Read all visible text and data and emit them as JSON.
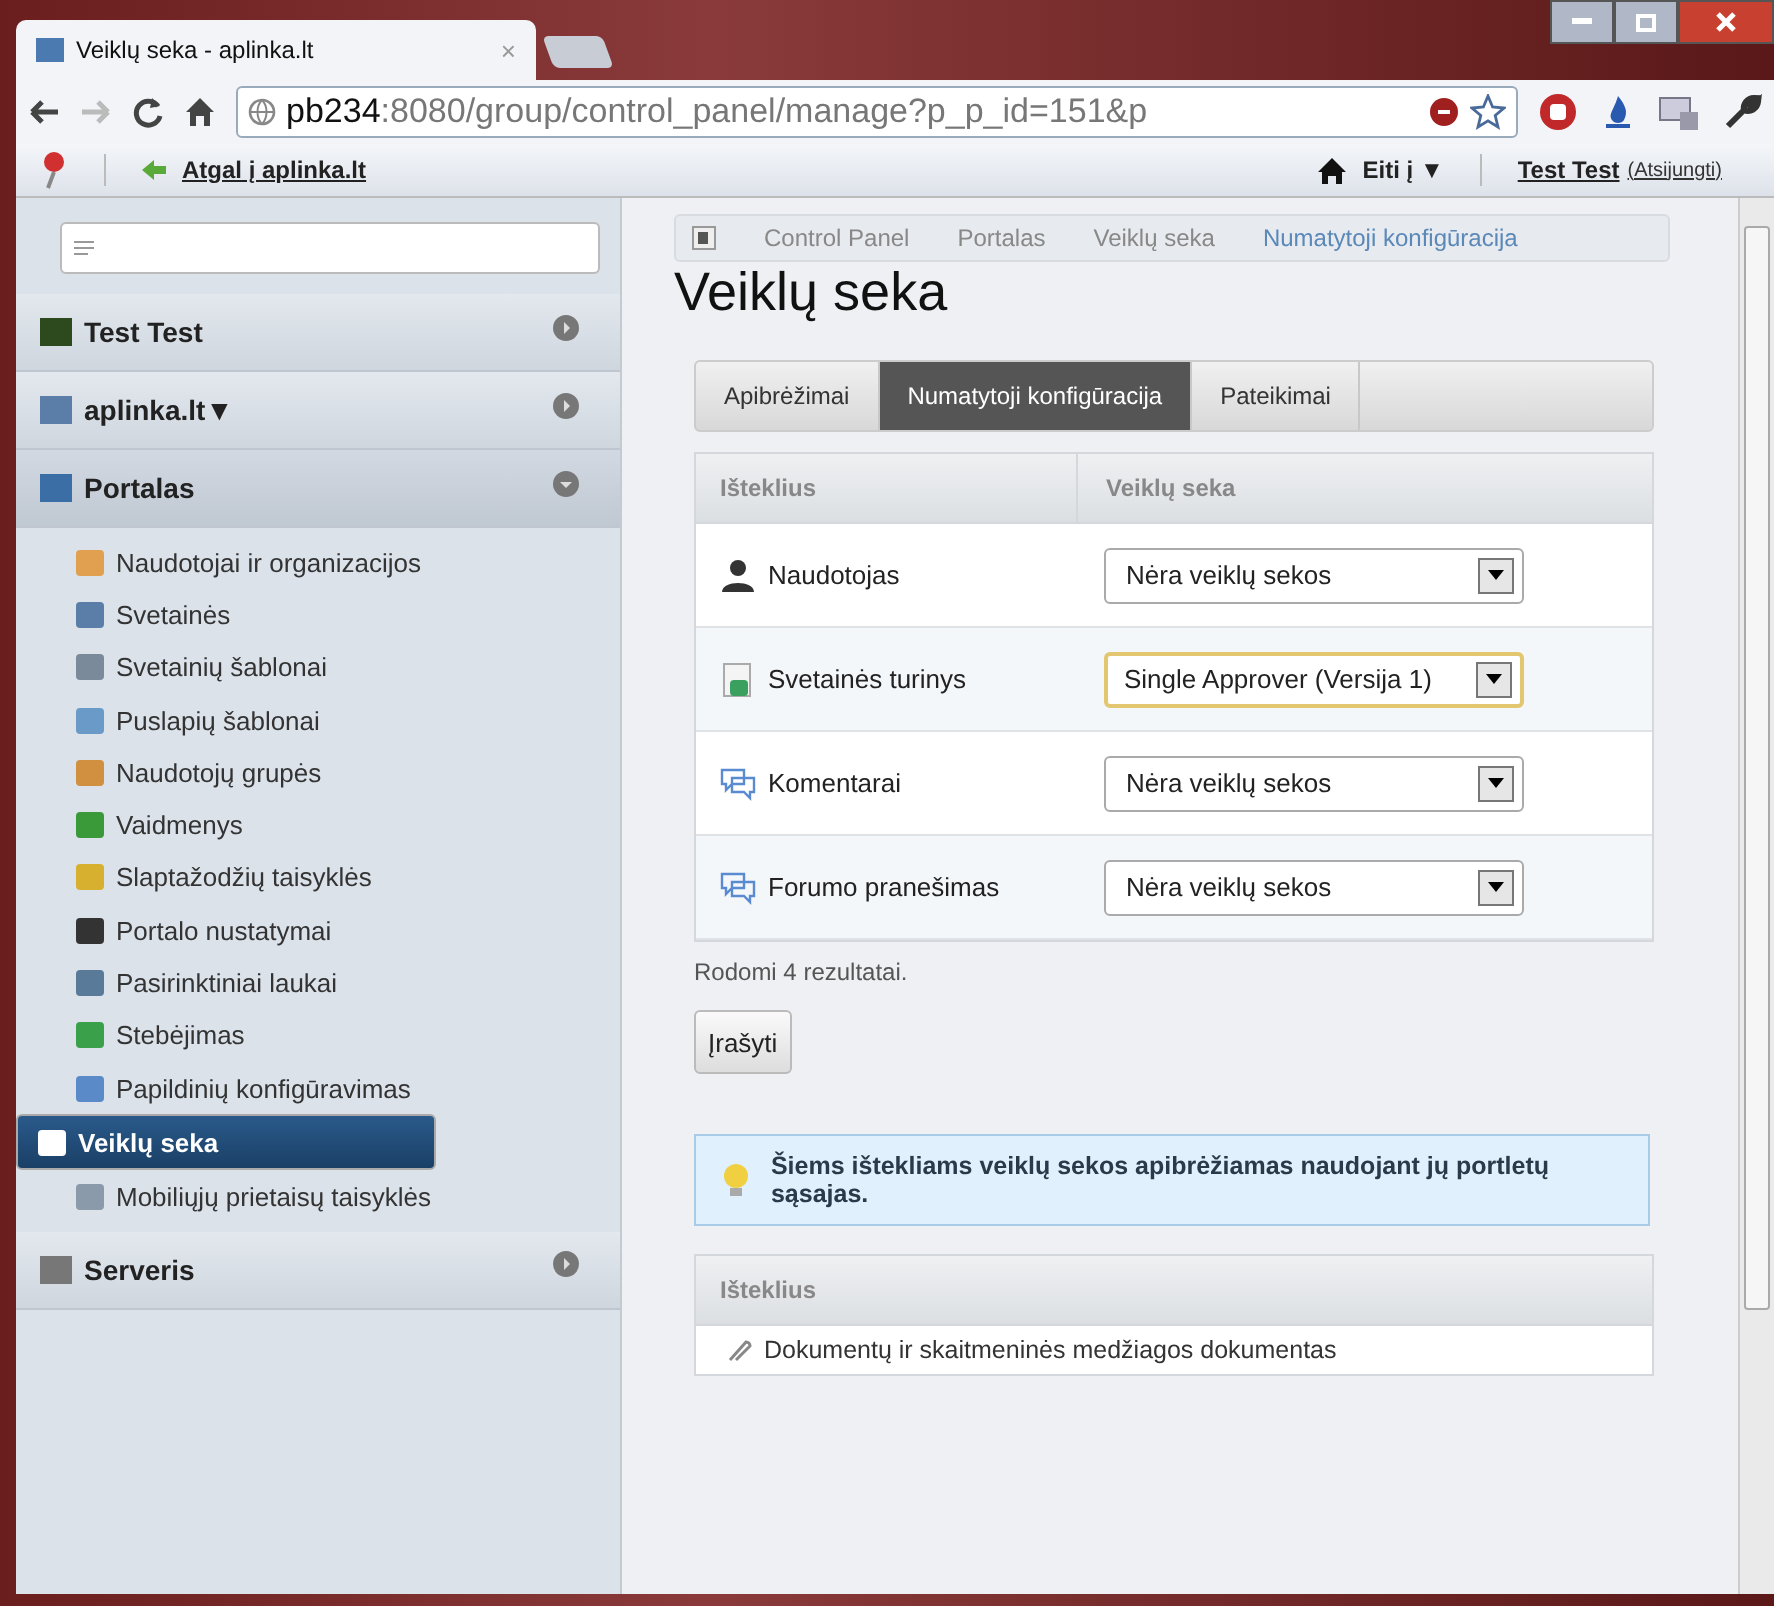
{
  "browser": {
    "tab_title": "Veiklų seka - aplinka.lt",
    "tab_close": "×",
    "url_host": "pb234",
    "url_rest": ":8080/group/control_panel/manage?p_p_id=151&p"
  },
  "dockbar": {
    "back_link": "Atgal į aplinka.lt",
    "goto": "Eiti į",
    "goto_caret": "▼",
    "user": "Test Test",
    "logout": "(Atsijungti)"
  },
  "sidebar": {
    "sections": [
      {
        "label": "Test Test",
        "expanded": false
      },
      {
        "label": "aplinka.lt",
        "caret": "▼",
        "expanded": false
      },
      {
        "label": "Portalas",
        "expanded": true,
        "items": [
          {
            "label": "Naudotojai ir organizacijos",
            "selected": false
          },
          {
            "label": "Svetainės",
            "selected": false
          },
          {
            "label": "Svetainių šablonai",
            "selected": false
          },
          {
            "label": "Puslapių šablonai",
            "selected": false
          },
          {
            "label": "Naudotojų grupės",
            "selected": false
          },
          {
            "label": "Vaidmenys",
            "selected": false
          },
          {
            "label": "Slaptažodžių taisyklės",
            "selected": false
          },
          {
            "label": "Portalo nustatymai",
            "selected": false
          },
          {
            "label": "Pasirinktiniai laukai",
            "selected": false
          },
          {
            "label": "Stebėjimas",
            "selected": false
          },
          {
            "label": "Papildinių konfigūravimas",
            "selected": false
          },
          {
            "label": "Veiklų seka",
            "selected": true
          },
          {
            "label": "Mobiliųjų prietaisų taisyklės",
            "selected": false
          }
        ]
      },
      {
        "label": "Serveris",
        "expanded": false
      }
    ]
  },
  "breadcrumb": [
    "Control Panel",
    "Portalas",
    "Veiklų seka",
    "Numatytoji konfigūracija"
  ],
  "title": "Veiklų seka",
  "tabs": [
    {
      "label": "Apibrėžimai",
      "selected": false
    },
    {
      "label": "Numatytoji konfigūracija",
      "selected": true
    },
    {
      "label": "Pateikimai",
      "selected": false
    }
  ],
  "table": {
    "columns": [
      "Išteklius",
      "Veiklų seka"
    ],
    "rows": [
      {
        "resource": "Naudotojas",
        "workflow": "Nėra veiklų sekos",
        "focused": false
      },
      {
        "resource": "Svetainės turinys",
        "workflow": "Single Approver (Versija 1)",
        "focused": true
      },
      {
        "resource": "Komentarai",
        "workflow": "Nėra veiklų sekos",
        "focused": false
      },
      {
        "resource": "Forumo pranešimas",
        "workflow": "Nėra veiklų sekos",
        "focused": false
      }
    ]
  },
  "results": "Rodomi 4 rezultatai.",
  "save_button": "Įrašyti",
  "info": "Šiems ištekliams veiklų sekos apibrėžiamas naudojant jų portletų sąsajas.",
  "table2": {
    "columns": [
      "Išteklius"
    ],
    "rows": [
      "Dokumentų ir skaitmeninės medžiagos dokumentas"
    ]
  }
}
